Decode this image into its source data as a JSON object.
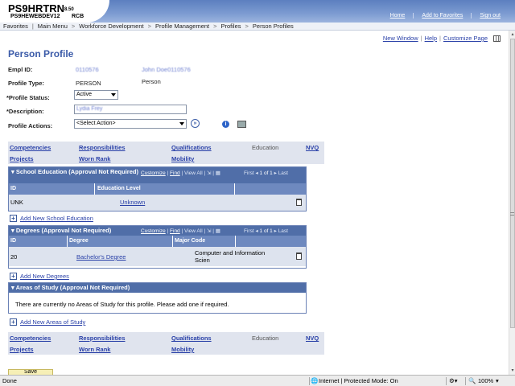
{
  "header": {
    "system_name": "PS9HRTRN",
    "system_version": "8.50",
    "server": "PS9HEWEBDEV12",
    "server_suffix": "RCB",
    "links": [
      "Home",
      "Add to Favorites",
      "Sign out"
    ]
  },
  "breadcrumb": [
    "Favorites",
    "Main Menu",
    "Workforce Development",
    "Profile Management",
    "Profiles",
    "Person Profiles"
  ],
  "toplinks": [
    "New Window",
    "Help",
    "Customize Page"
  ],
  "page_title": "Person Profile",
  "form": {
    "empl_id_label": "Empl ID:",
    "empl_id_value": "0110576",
    "empl_name_value": "John Doe0110576",
    "profile_type_label": "Profile Type:",
    "profile_type_value": "PERSON",
    "profile_type_desc": "Person",
    "profile_status_label": "*Profile Status:",
    "profile_status_value": "Active",
    "description_label": "*Description:",
    "description_value": "Lydia Frey",
    "profile_actions_label": "Profile Actions:",
    "profile_actions_value": "<Select Action>"
  },
  "tabs": {
    "row1": [
      "Competencies",
      "Responsibilities",
      "Qualifications",
      "Education",
      "NVQ"
    ],
    "row2": [
      "Projects",
      "Worn Rank",
      "Mobility"
    ],
    "current": "Education"
  },
  "grid_tools": {
    "customize": "Customize",
    "find": "Find",
    "view_all": "View All",
    "first": "First",
    "range": "1 of 1",
    "last": "Last"
  },
  "school_education": {
    "title": "School Education (Approval Not Required)",
    "columns": [
      "ID",
      "Education Level"
    ],
    "rows": [
      {
        "id": "UNK",
        "level": "Unknown"
      }
    ],
    "add_label": "Add New School Education"
  },
  "degrees": {
    "title": "Degrees (Approval Not Required)",
    "columns": [
      "ID",
      "Degree",
      "Major Code"
    ],
    "rows": [
      {
        "id": "20",
        "degree": "Bachelor's Degree",
        "major": "Computer and Information Scien"
      }
    ],
    "add_label": "Add New Degrees"
  },
  "areas_of_study": {
    "title": "Areas of Study (Approval Not Required)",
    "message": "There are currently no Areas of Study for this profile.  Please add one if required.",
    "add_label": "Add New Areas of Study"
  },
  "save_label": "Save",
  "status_bar": {
    "left": "Done",
    "zone": "Internet | Protected Mode: On",
    "zoom": "100%"
  }
}
